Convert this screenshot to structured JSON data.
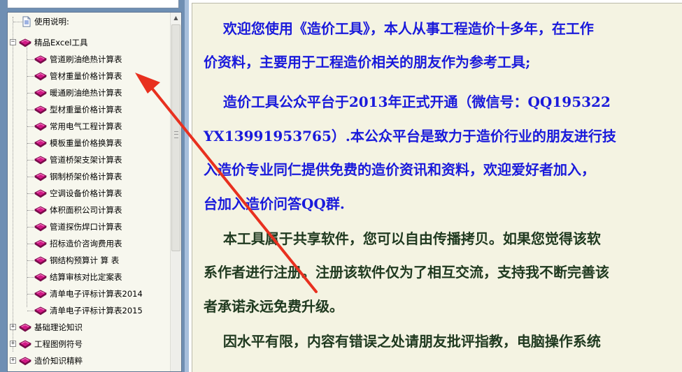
{
  "tree": {
    "top_items": [
      {
        "label": "使用说明:",
        "icon": "document-icon",
        "expander": ""
      }
    ],
    "group_excel": {
      "label": "精品Excel工具",
      "icon": "book-icon",
      "expander": "−"
    },
    "excel_items": [
      "管道刷油绝热计算表",
      "管材重量价格计算表",
      "暖通刷油绝热计算表",
      "型材重量价格计算表",
      "常用电气工程计算表",
      "模板重量价格换算表",
      "管道桥架支架计算表",
      "钢制桥架价格计算表",
      "空调设备价格计算表",
      "体积面积公司计算表",
      "管道探伤焊口计算表",
      "招标造价咨询费用表",
      "钢结构预算计 算 表",
      "结算审核对比定案表",
      "清单电子评标计算表2014",
      "清单电子评标计算表2015"
    ],
    "other_groups": [
      {
        "label": "基础理论知识",
        "expander": "+"
      },
      {
        "label": "工程图例符号",
        "expander": "+"
      },
      {
        "label": "造价知识精粹",
        "expander": "+"
      }
    ]
  },
  "content": {
    "paragraphs": [
      {
        "lines": [
          "    欢迎您使用《造价工具》，本人从事工程造价十多年，在工作",
          "价资料，主要用于工程造价相关的朋友作为参考工具;"
        ],
        "color": "#1a1adb"
      },
      {
        "lines": [
          "    造价工具公众平台于2013年正式开通（微信号：QQ195322",
          "YX13991953765）.本公众平台是致力于造价行业的朋友进行技",
          "入造价专业同仁提供免费的造价资讯和资料，欢迎爱好者加入，",
          "台加入造价问答QQ群."
        ],
        "color": "#1a1adb"
      },
      {
        "lines": [
          "    本工具属于共享软件，您可以自由传播拷贝。如果您觉得该软",
          "系作者进行注册。注册该软件仅为了相互交流，支持我不断完善该",
          "者承诺永远免费升级。"
        ],
        "color": "#203a20"
      },
      {
        "lines": [
          "    因水平有限，内容有错误之处请朋友批评指教，电脑操作系统"
        ],
        "color": "#203a20"
      }
    ]
  },
  "colors": {
    "tree_bg": "#f7f7ee",
    "content_bg": "#f4f3e2",
    "blue_text": "#1a1adb",
    "dark_text": "#203a20",
    "annotation_arrow": "#e8301f",
    "book_icon": "#c8157d"
  },
  "annotation": {
    "type": "arrow",
    "icon": "red-arrow-annotation"
  }
}
